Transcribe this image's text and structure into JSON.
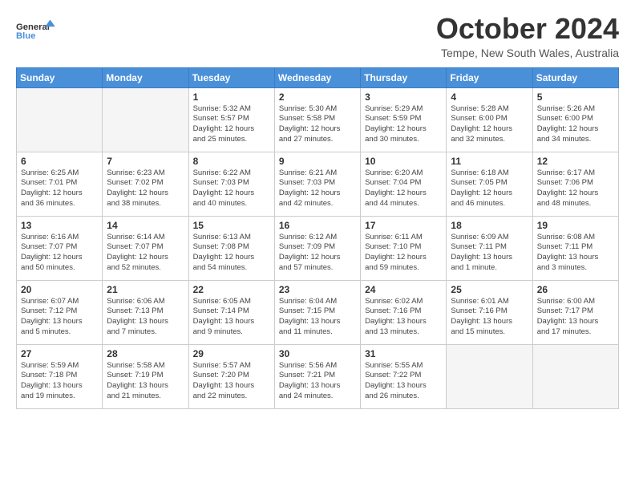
{
  "logo": {
    "line1": "General",
    "line2": "Blue"
  },
  "title": "October 2024",
  "location": "Tempe, New South Wales, Australia",
  "days_of_week": [
    "Sunday",
    "Monday",
    "Tuesday",
    "Wednesday",
    "Thursday",
    "Friday",
    "Saturday"
  ],
  "weeks": [
    [
      {
        "day": "",
        "content": ""
      },
      {
        "day": "",
        "content": ""
      },
      {
        "day": "1",
        "content": "Sunrise: 5:32 AM\nSunset: 5:57 PM\nDaylight: 12 hours\nand 25 minutes."
      },
      {
        "day": "2",
        "content": "Sunrise: 5:30 AM\nSunset: 5:58 PM\nDaylight: 12 hours\nand 27 minutes."
      },
      {
        "day": "3",
        "content": "Sunrise: 5:29 AM\nSunset: 5:59 PM\nDaylight: 12 hours\nand 30 minutes."
      },
      {
        "day": "4",
        "content": "Sunrise: 5:28 AM\nSunset: 6:00 PM\nDaylight: 12 hours\nand 32 minutes."
      },
      {
        "day": "5",
        "content": "Sunrise: 5:26 AM\nSunset: 6:00 PM\nDaylight: 12 hours\nand 34 minutes."
      }
    ],
    [
      {
        "day": "6",
        "content": "Sunrise: 6:25 AM\nSunset: 7:01 PM\nDaylight: 12 hours\nand 36 minutes."
      },
      {
        "day": "7",
        "content": "Sunrise: 6:23 AM\nSunset: 7:02 PM\nDaylight: 12 hours\nand 38 minutes."
      },
      {
        "day": "8",
        "content": "Sunrise: 6:22 AM\nSunset: 7:03 PM\nDaylight: 12 hours\nand 40 minutes."
      },
      {
        "day": "9",
        "content": "Sunrise: 6:21 AM\nSunset: 7:03 PM\nDaylight: 12 hours\nand 42 minutes."
      },
      {
        "day": "10",
        "content": "Sunrise: 6:20 AM\nSunset: 7:04 PM\nDaylight: 12 hours\nand 44 minutes."
      },
      {
        "day": "11",
        "content": "Sunrise: 6:18 AM\nSunset: 7:05 PM\nDaylight: 12 hours\nand 46 minutes."
      },
      {
        "day": "12",
        "content": "Sunrise: 6:17 AM\nSunset: 7:06 PM\nDaylight: 12 hours\nand 48 minutes."
      }
    ],
    [
      {
        "day": "13",
        "content": "Sunrise: 6:16 AM\nSunset: 7:07 PM\nDaylight: 12 hours\nand 50 minutes."
      },
      {
        "day": "14",
        "content": "Sunrise: 6:14 AM\nSunset: 7:07 PM\nDaylight: 12 hours\nand 52 minutes."
      },
      {
        "day": "15",
        "content": "Sunrise: 6:13 AM\nSunset: 7:08 PM\nDaylight: 12 hours\nand 54 minutes."
      },
      {
        "day": "16",
        "content": "Sunrise: 6:12 AM\nSunset: 7:09 PM\nDaylight: 12 hours\nand 57 minutes."
      },
      {
        "day": "17",
        "content": "Sunrise: 6:11 AM\nSunset: 7:10 PM\nDaylight: 12 hours\nand 59 minutes."
      },
      {
        "day": "18",
        "content": "Sunrise: 6:09 AM\nSunset: 7:11 PM\nDaylight: 13 hours\nand 1 minute."
      },
      {
        "day": "19",
        "content": "Sunrise: 6:08 AM\nSunset: 7:11 PM\nDaylight: 13 hours\nand 3 minutes."
      }
    ],
    [
      {
        "day": "20",
        "content": "Sunrise: 6:07 AM\nSunset: 7:12 PM\nDaylight: 13 hours\nand 5 minutes."
      },
      {
        "day": "21",
        "content": "Sunrise: 6:06 AM\nSunset: 7:13 PM\nDaylight: 13 hours\nand 7 minutes."
      },
      {
        "day": "22",
        "content": "Sunrise: 6:05 AM\nSunset: 7:14 PM\nDaylight: 13 hours\nand 9 minutes."
      },
      {
        "day": "23",
        "content": "Sunrise: 6:04 AM\nSunset: 7:15 PM\nDaylight: 13 hours\nand 11 minutes."
      },
      {
        "day": "24",
        "content": "Sunrise: 6:02 AM\nSunset: 7:16 PM\nDaylight: 13 hours\nand 13 minutes."
      },
      {
        "day": "25",
        "content": "Sunrise: 6:01 AM\nSunset: 7:16 PM\nDaylight: 13 hours\nand 15 minutes."
      },
      {
        "day": "26",
        "content": "Sunrise: 6:00 AM\nSunset: 7:17 PM\nDaylight: 13 hours\nand 17 minutes."
      }
    ],
    [
      {
        "day": "27",
        "content": "Sunrise: 5:59 AM\nSunset: 7:18 PM\nDaylight: 13 hours\nand 19 minutes."
      },
      {
        "day": "28",
        "content": "Sunrise: 5:58 AM\nSunset: 7:19 PM\nDaylight: 13 hours\nand 21 minutes."
      },
      {
        "day": "29",
        "content": "Sunrise: 5:57 AM\nSunset: 7:20 PM\nDaylight: 13 hours\nand 22 minutes."
      },
      {
        "day": "30",
        "content": "Sunrise: 5:56 AM\nSunset: 7:21 PM\nDaylight: 13 hours\nand 24 minutes."
      },
      {
        "day": "31",
        "content": "Sunrise: 5:55 AM\nSunset: 7:22 PM\nDaylight: 13 hours\nand 26 minutes."
      },
      {
        "day": "",
        "content": ""
      },
      {
        "day": "",
        "content": ""
      }
    ]
  ]
}
